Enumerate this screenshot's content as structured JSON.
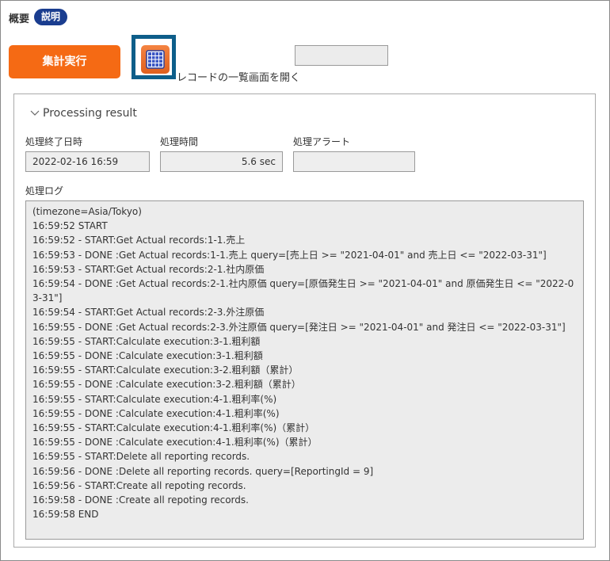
{
  "header": {
    "label": "概要",
    "badge": "説明"
  },
  "toolbar": {
    "run_label": "集計実行",
    "open_list_label": "レコードの一覧画面を開く",
    "text_field_value": ""
  },
  "result": {
    "title": "Processing result",
    "end_time_label": "処理終了日時",
    "end_time_value": "2022-02-16 16:59",
    "duration_label": "処理時間",
    "duration_value": "5.6 sec",
    "alert_label": "処理アラート",
    "alert_value": "",
    "log_label": "処理ログ",
    "log_lines": [
      "(timezone=Asia/Tokyo)",
      "16:59:52 START",
      "16:59:52 - START:Get Actual records:1-1.売上",
      "16:59:53 - DONE :Get Actual records:1-1.売上 query=[売上日 >= \"2021-04-01\" and 売上日 <= \"2022-03-31\"]",
      "16:59:53 - START:Get Actual records:2-1.社内原価",
      "16:59:54 - DONE :Get Actual records:2-1.社内原価 query=[原価発生日 >= \"2021-04-01\" and 原価発生日 <= \"2022-03-31\"]",
      "16:59:54 - START:Get Actual records:2-3.外注原価",
      "16:59:55 - DONE :Get Actual records:2-3.外注原価 query=[発注日 >= \"2021-04-01\" and 発注日 <= \"2022-03-31\"]",
      "16:59:55 - START:Calculate execution:3-1.粗利額",
      "16:59:55 - DONE :Calculate execution:3-1.粗利額",
      "16:59:55 - START:Calculate execution:3-2.粗利額（累計）",
      "16:59:55 - DONE :Calculate execution:3-2.粗利額（累計）",
      "16:59:55 - START:Calculate execution:4-1.粗利率(%)",
      "16:59:55 - DONE :Calculate execution:4-1.粗利率(%)",
      "16:59:55 - START:Calculate execution:4-1.粗利率(%)（累計）",
      "16:59:55 - DONE :Calculate execution:4-1.粗利率(%)（累計）",
      "16:59:55 - START:Delete all reporting records.",
      "16:59:56 - DONE :Delete all reporting records. query=[ReportingId = 9]",
      "16:59:56 - START:Create all repoting records.",
      "16:59:58 - DONE :Create all repoting records.",
      "16:59:58 END"
    ]
  },
  "icons": {
    "list_view": "table-grid-icon",
    "collapse": "chevron-down-icon"
  },
  "colors": {
    "accent_orange": "#f56a14",
    "badge_blue": "#1a3d8f",
    "highlight_blue": "#0d5e8a"
  }
}
